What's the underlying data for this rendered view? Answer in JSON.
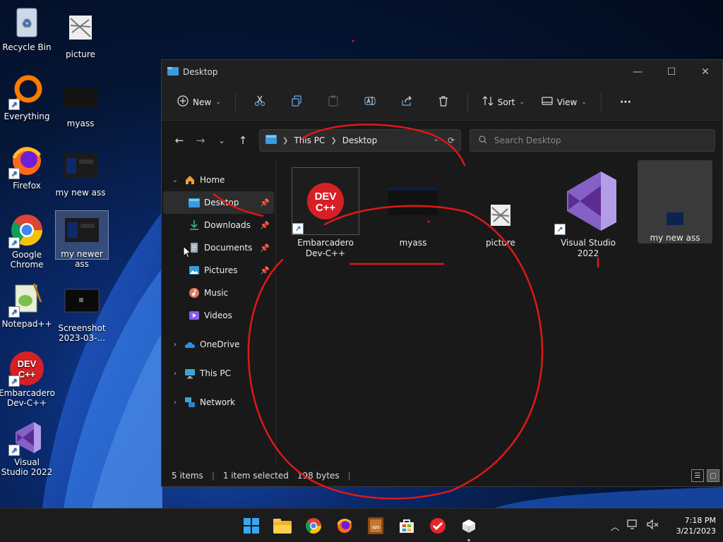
{
  "desktop": {
    "icons": [
      {
        "label": "Recycle Bin",
        "icon": "recycle-bin-icon"
      },
      {
        "label": "picture",
        "icon": "picture-icon"
      },
      {
        "label": "Everything",
        "icon": "everything-icon"
      },
      {
        "label": "myass",
        "icon": "image-file-icon"
      },
      {
        "label": "Firefox",
        "icon": "firefox-icon"
      },
      {
        "label": "my new ass",
        "icon": "image-file-icon"
      },
      {
        "label": "Google Chrome",
        "icon": "chrome-icon"
      },
      {
        "label": "my newer ass",
        "icon": "image-file-icon"
      },
      {
        "label": "Notepad++",
        "icon": "notepad-plus-plus-icon"
      },
      {
        "label": "Screenshot 2023-03-...",
        "icon": "screenshot-file-icon"
      },
      {
        "label": "Embarcadero Dev-C++",
        "icon": "dev-cpp-icon"
      },
      {
        "label": "Visual Studio 2022",
        "icon": "visual-studio-icon"
      }
    ]
  },
  "explorer": {
    "title": "Desktop",
    "window_controls": {
      "minimize": "—",
      "maximize": "☐",
      "close": "✕"
    },
    "toolbar": {
      "new_label": "New",
      "sort_label": "Sort",
      "view_label": "View",
      "more_label": "···"
    },
    "address": {
      "segments": [
        "This PC",
        "Desktop"
      ]
    },
    "search": {
      "placeholder": "Search Desktop"
    },
    "sidebar": {
      "home": "Home",
      "quick": [
        {
          "label": "Desktop",
          "pinned": true
        },
        {
          "label": "Downloads",
          "pinned": true
        },
        {
          "label": "Documents",
          "pinned": true
        },
        {
          "label": "Pictures",
          "pinned": true
        },
        {
          "label": "Music",
          "pinned": false
        },
        {
          "label": "Videos",
          "pinned": false
        }
      ],
      "onedrive": "OneDrive",
      "thispc": "This PC",
      "network": "Network"
    },
    "files": [
      {
        "name": "Embarcadero Dev-C++",
        "icon": "dev-cpp-icon",
        "selected": true
      },
      {
        "name": "myass",
        "icon": "image-file-icon"
      },
      {
        "name": "picture",
        "icon": "picture-icon"
      },
      {
        "name": "Visual Studio 2022",
        "icon": "visual-studio-icon"
      },
      {
        "name": "my new ass",
        "icon": "image-file-icon",
        "highlighted": true
      }
    ],
    "status": {
      "count": "5 items",
      "selection": "1 item selected",
      "size": "198 bytes"
    }
  },
  "taskbar": {
    "apps": [
      "windows-start-icon",
      "file-explorer-icon",
      "chrome-icon",
      "firefox-icon",
      "winrar-icon",
      "microsoft-store-icon",
      "todo-check-icon",
      "explorer-cube-icon"
    ],
    "time": "7:18 PM",
    "date": "3/21/2023"
  },
  "colors": {
    "accent": "#0078d4",
    "annotation_red": "#e01818",
    "window_bg": "#191919",
    "toolbar_bg": "#202020"
  }
}
